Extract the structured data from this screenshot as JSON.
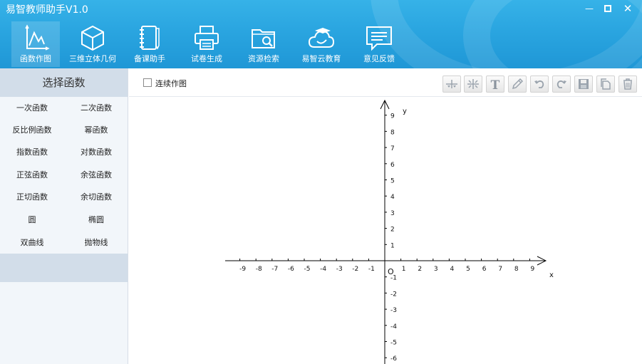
{
  "window": {
    "title": "易智教师助手V1.0"
  },
  "main_tools": [
    {
      "label": "函数作图",
      "icon": "function-graph-icon",
      "active": true
    },
    {
      "label": "三维立体几何",
      "icon": "3d-cube-icon",
      "active": false
    },
    {
      "label": "备课助手",
      "icon": "notebook-icon",
      "active": false
    },
    {
      "label": "试卷生成",
      "icon": "printer-icon",
      "active": false
    },
    {
      "label": "资源检索",
      "icon": "folder-search-icon",
      "active": false
    },
    {
      "label": "易智云教育",
      "icon": "cloud-education-icon",
      "active": false
    },
    {
      "label": "意见反馈",
      "icon": "feedback-icon",
      "active": false
    }
  ],
  "sidebar": {
    "title": "选择函数",
    "functions": [
      [
        "一次函数",
        "二次函数"
      ],
      [
        "反比例函数",
        "幂函数"
      ],
      [
        "指数函数",
        "对数函数"
      ],
      [
        "正弦函数",
        "余弦函数"
      ],
      [
        "正切函数",
        "余切函数"
      ],
      [
        "圆",
        "椭圆"
      ],
      [
        "双曲线",
        "抛物线"
      ]
    ]
  },
  "toolbar": {
    "continuous_label": "连续作图",
    "continuous_checked": false,
    "buttons": [
      "x-axis-tool-icon",
      "y-axis-tool-icon",
      "text-tool-icon",
      "pencil-icon",
      "undo-icon",
      "redo-icon",
      "save-icon",
      "copy-icon",
      "delete-icon"
    ],
    "text_glyph": "T"
  },
  "graph": {
    "x_label": "x",
    "y_label": "y",
    "origin_label": "O",
    "x_ticks": [
      -9,
      -8,
      -7,
      -6,
      -5,
      -4,
      -3,
      -2,
      -1,
      1,
      2,
      3,
      4,
      5,
      6,
      7,
      8,
      9
    ],
    "y_ticks": [
      9,
      8,
      7,
      6,
      5,
      4,
      3,
      2,
      1,
      -1,
      -2,
      -3,
      -4,
      -5,
      -6
    ]
  }
}
